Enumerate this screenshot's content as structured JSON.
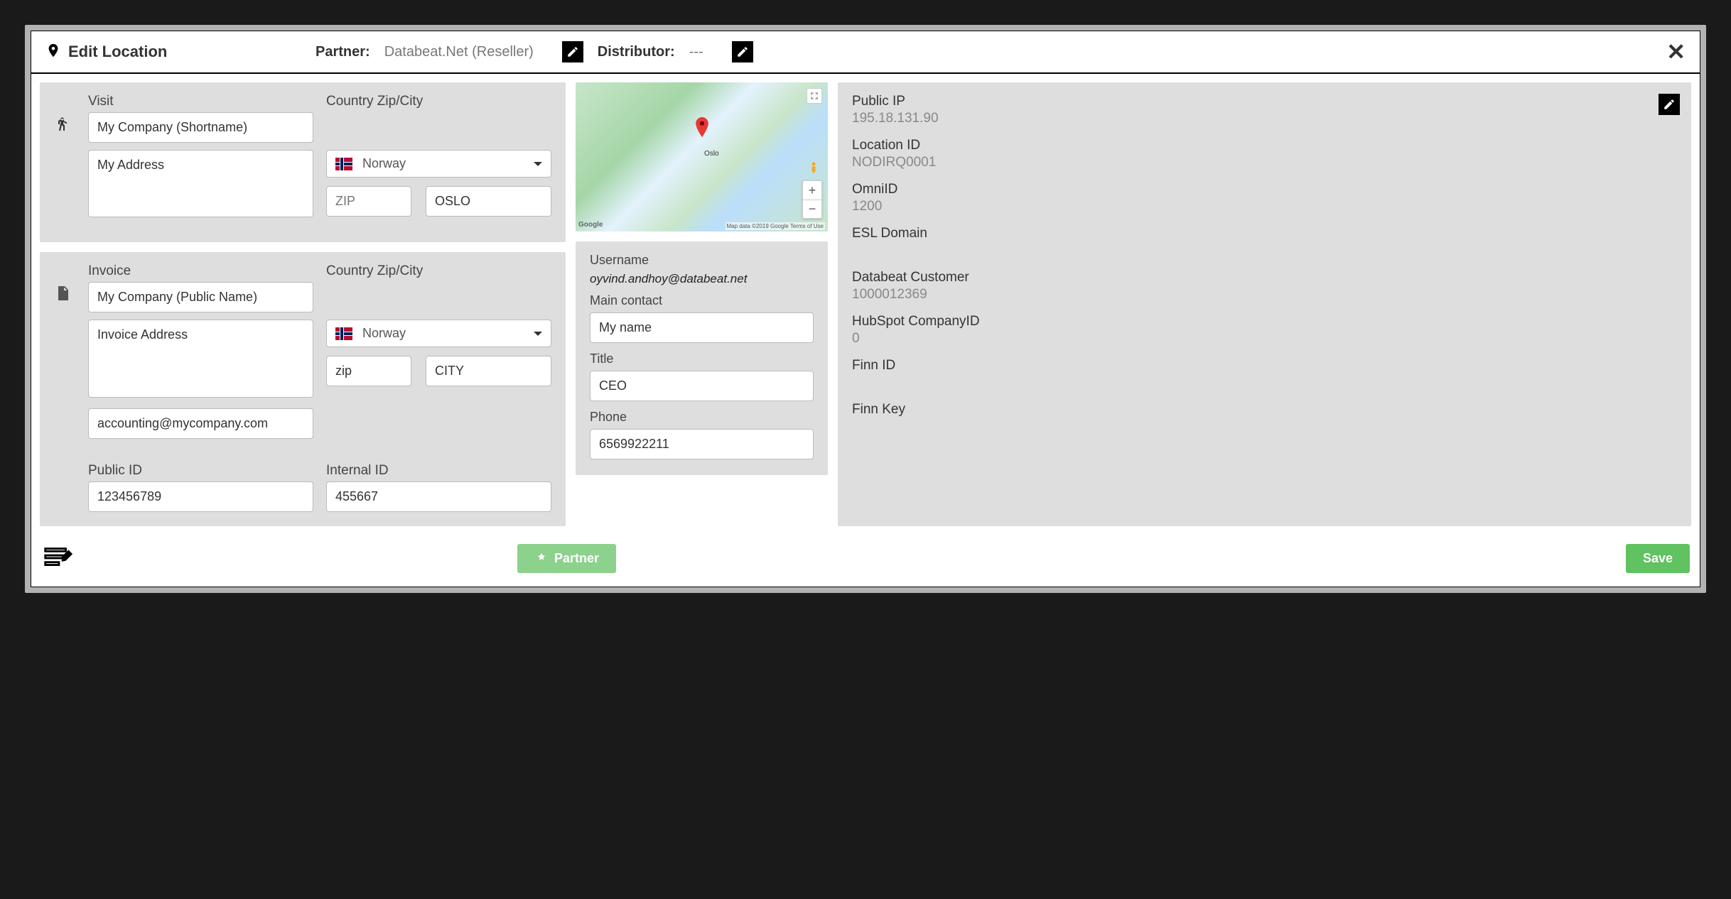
{
  "header": {
    "title": "Edit Location",
    "partner_label": "Partner:",
    "partner_value": "Databeat.Net (Reseller)",
    "distributor_label": "Distributor:",
    "distributor_value": "---"
  },
  "visit": {
    "title": "Visit",
    "country_title": "Country Zip/City",
    "shortname": "My Company (Shortname)",
    "address": "My Address",
    "country": "Norway",
    "zip_placeholder": "ZIP",
    "zip": "",
    "city": "OSLO"
  },
  "invoice": {
    "title": "Invoice",
    "country_title": "Country Zip/City",
    "publicname": "My Company (Public Name)",
    "address": "Invoice Address",
    "country": "Norway",
    "zip": "zip",
    "city": "CITY",
    "email": "accounting@mycompany.com",
    "public_id_label": "Public ID",
    "public_id": "123456789",
    "internal_id_label": "Internal ID",
    "internal_id": "455667"
  },
  "map": {
    "city_label": "Oslo",
    "attrib": "Map data ©2019 Google   Terms of Use",
    "logo": "Google"
  },
  "contact": {
    "username_label": "Username",
    "username": "oyvind.andhoy@databeat.net",
    "main_contact_label": "Main contact",
    "main_contact": "My name",
    "title_label": "Title",
    "title": "CEO",
    "phone_label": "Phone",
    "phone": "6569922211"
  },
  "info": {
    "public_ip_label": "Public IP",
    "public_ip": "195.18.131.90",
    "location_id_label": "Location ID",
    "location_id": "NODIRQ0001",
    "omni_id_label": "OmniID",
    "omni_id": "1200",
    "esl_domain_label": "ESL Domain",
    "esl_domain": "",
    "databeat_customer_label": "Databeat Customer",
    "databeat_customer": "1000012369",
    "hubspot_label": "HubSpot CompanyID",
    "hubspot": "0",
    "finn_id_label": "Finn ID",
    "finn_id": "",
    "finn_key_label": "Finn Key",
    "finn_key": ""
  },
  "footer": {
    "partner_btn": "Partner",
    "save_btn": "Save"
  }
}
